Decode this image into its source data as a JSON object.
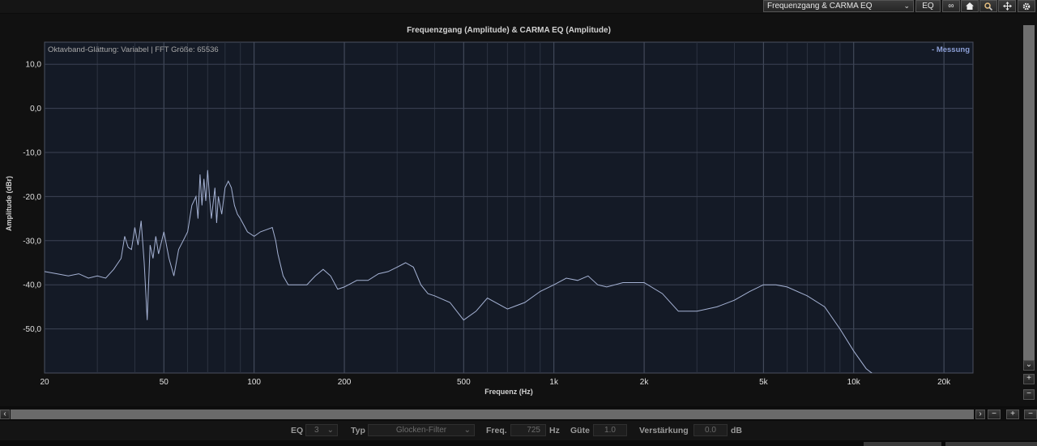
{
  "toolbar": {
    "view_select": "Frequenzgang & CARMA EQ",
    "eq_button": "EQ",
    "link_icon": "infinity-icon",
    "home_icon": "home-icon",
    "zoom_icon": "magnifier-icon",
    "pan_icon": "move-icon",
    "settings_icon": "gear-icon"
  },
  "chart": {
    "title": "Frequenzgang (Amplitude) & CARMA EQ (Amplitude)",
    "info": "Oktavband-Glättung: Variabel | FFT Größe: 65536",
    "legend": "- Messung",
    "xlabel": "Frequenz (Hz)",
    "ylabel": "Amplitude (dBr)"
  },
  "chart_data": {
    "type": "line",
    "title": "Frequenzgang (Amplitude) & CARMA EQ (Amplitude)",
    "xlabel": "Frequenz (Hz)",
    "ylabel": "Amplitude (dBr)",
    "x_scale": "log",
    "xlim": [
      20,
      25000
    ],
    "ylim": [
      -60,
      15
    ],
    "x_ticks": [
      20,
      50,
      100,
      200,
      500,
      1000,
      2000,
      5000,
      10000,
      20000
    ],
    "x_tick_labels": [
      "20",
      "50",
      "100",
      "200",
      "500",
      "1k",
      "2k",
      "5k",
      "10k",
      "20k"
    ],
    "y_ticks": [
      10,
      0,
      -10,
      -20,
      -30,
      -40,
      -50
    ],
    "y_tick_labels": [
      "10,0",
      "0,0",
      "-10,0",
      "-20,0",
      "-30,0",
      "-40,0",
      "-50,0"
    ],
    "grid": true,
    "legend_position": "top-right",
    "colors": {
      "background": "#141a26",
      "grid": "#3c4354",
      "series": "#a5b2d4"
    },
    "series": [
      {
        "name": "Messung",
        "x": [
          20,
          22,
          24,
          26,
          28,
          30,
          32,
          34,
          36,
          37,
          38,
          39,
          40,
          41,
          42,
          43,
          44,
          45,
          46,
          47,
          48,
          50,
          52,
          53,
          54,
          56,
          58,
          60,
          62,
          64,
          65,
          66,
          67,
          68,
          69,
          70,
          71,
          72,
          74,
          75,
          76,
          78,
          80,
          82,
          84,
          86,
          88,
          90,
          95,
          100,
          105,
          110,
          115,
          118,
          120,
          125,
          130,
          140,
          150,
          160,
          170,
          180,
          190,
          200,
          220,
          240,
          260,
          280,
          300,
          320,
          340,
          360,
          380,
          400,
          450,
          500,
          550,
          600,
          700,
          800,
          900,
          1000,
          1100,
          1200,
          1300,
          1400,
          1500,
          1700,
          2000,
          2300,
          2600,
          3000,
          3500,
          4000,
          4500,
          5000,
          5500,
          6000,
          7000,
          8000,
          9000,
          10000,
          11000,
          12000
        ],
        "y": [
          -37,
          -37.5,
          -38,
          -37.5,
          -38.5,
          -38,
          -38.5,
          -36.5,
          -34,
          -29,
          -31.5,
          -32,
          -27,
          -31,
          -25.5,
          -35,
          -48,
          -31,
          -34,
          -29,
          -33,
          -28,
          -34,
          -36,
          -38,
          -32,
          -30,
          -28,
          -22,
          -20,
          -25,
          -15,
          -22,
          -16,
          -21,
          -14,
          -20,
          -25,
          -18,
          -26,
          -20,
          -24,
          -18,
          -16.5,
          -18,
          -22,
          -24,
          -25,
          -28,
          -29,
          -28,
          -27.5,
          -27,
          -30,
          -33,
          -38,
          -40,
          -40,
          -40,
          -38,
          -36.5,
          -38,
          -41,
          -40.5,
          -39,
          -39,
          -37.5,
          -37,
          -36,
          -35,
          -36,
          -40,
          -42,
          -42.5,
          -44,
          -48,
          -46,
          -43,
          -45.5,
          -44,
          -41.5,
          -40,
          -38.5,
          -39,
          -38,
          -40,
          -40.5,
          -39.5,
          -39.5,
          -42,
          -46,
          -46,
          -45,
          -43.5,
          -41.5,
          -40,
          -40,
          -40.5,
          -42.5,
          -45,
          -50,
          -55,
          -59,
          -61
        ]
      }
    ]
  },
  "eq_panel": {
    "eq_label": "EQ",
    "eq_value": "3",
    "typ_label": "Typ",
    "typ_value": "Glocken-Filter",
    "freq_label": "Freq.",
    "freq_value": "725",
    "freq_unit": "Hz",
    "guete_label": "Güte",
    "guete_value": "1.0",
    "gain_label": "Verstärkung",
    "gain_value": "0.0",
    "gain_unit": "dB"
  }
}
